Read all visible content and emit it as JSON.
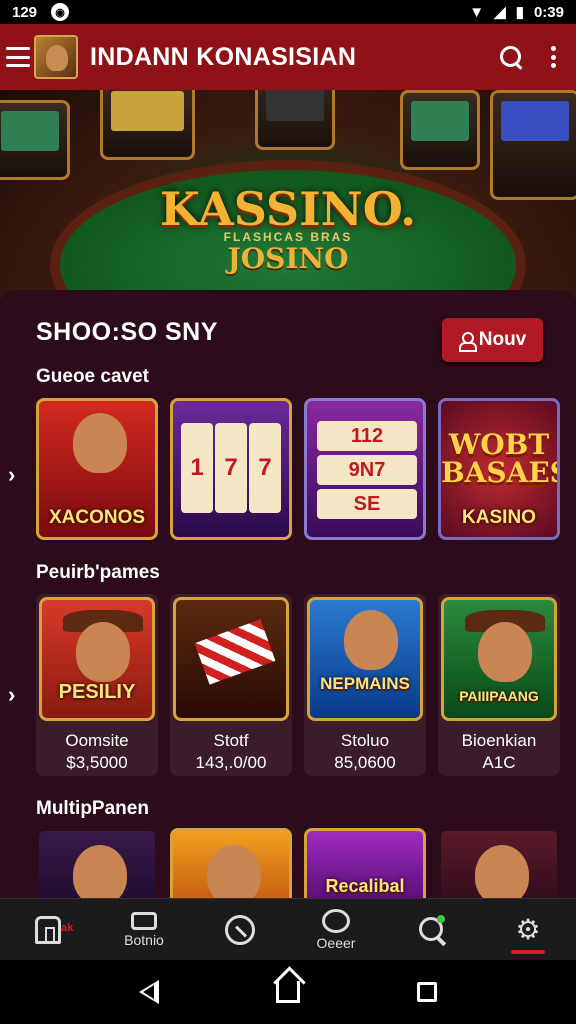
{
  "status_bar": {
    "left_time": "129",
    "right_time": "0:39"
  },
  "app_bar": {
    "title": "INDANN KONASISIAN"
  },
  "hero": {
    "title": "KASSINO.",
    "small_text": "FLASHCAS BRAS",
    "subtitle": "JOSINO"
  },
  "choose_section": {
    "title": "SHOO:SO SNY",
    "new_button_label": "Nouv"
  },
  "row1": {
    "label": "Gueoe cavet",
    "cards": [
      {
        "caption": "XACONOS"
      },
      {
        "reels": [
          "1",
          "7",
          "7"
        ]
      },
      {
        "reels": [
          "112",
          "9N7",
          "SE"
        ]
      },
      {
        "big": "WOBT BASAES",
        "caption": "KASINO"
      }
    ]
  },
  "row2": {
    "label": "Peuirb'pames",
    "cards": [
      {
        "art_text": "PESILIY",
        "name": "Oomsite",
        "amount": "$3,5000"
      },
      {
        "name": "Stotf",
        "amount": "143,.0/00"
      },
      {
        "art_text": "NEPMAINS",
        "name": "Stoluo",
        "amount": "85,0600"
      },
      {
        "art_text": "PAIIIPAANG",
        "name": "Bioenkian",
        "amount": "A1C"
      }
    ]
  },
  "row3": {
    "label": "MultipPanen",
    "cards": [
      {
        "caption": ""
      },
      {
        "caption": ""
      },
      {
        "caption": "Recalibal"
      },
      {
        "caption": ""
      }
    ]
  },
  "bottom_nav": {
    "items": [
      {
        "label": "",
        "badge": "ak"
      },
      {
        "label": "Botnio"
      },
      {
        "label": ""
      },
      {
        "label": "Oeeer"
      },
      {
        "label": ""
      },
      {
        "label": ""
      }
    ]
  },
  "colors": {
    "brand": "#8e1218",
    "accent": "#b11a25",
    "gold": "#d6a23c",
    "panel": "#2c0c1a"
  },
  "icons": [
    "menu-icon",
    "search-icon",
    "more-vert-icon",
    "person-icon",
    "chevron-right-icon",
    "home-icon",
    "ticket-icon",
    "target-icon",
    "shield-icon",
    "gear-icon"
  ]
}
